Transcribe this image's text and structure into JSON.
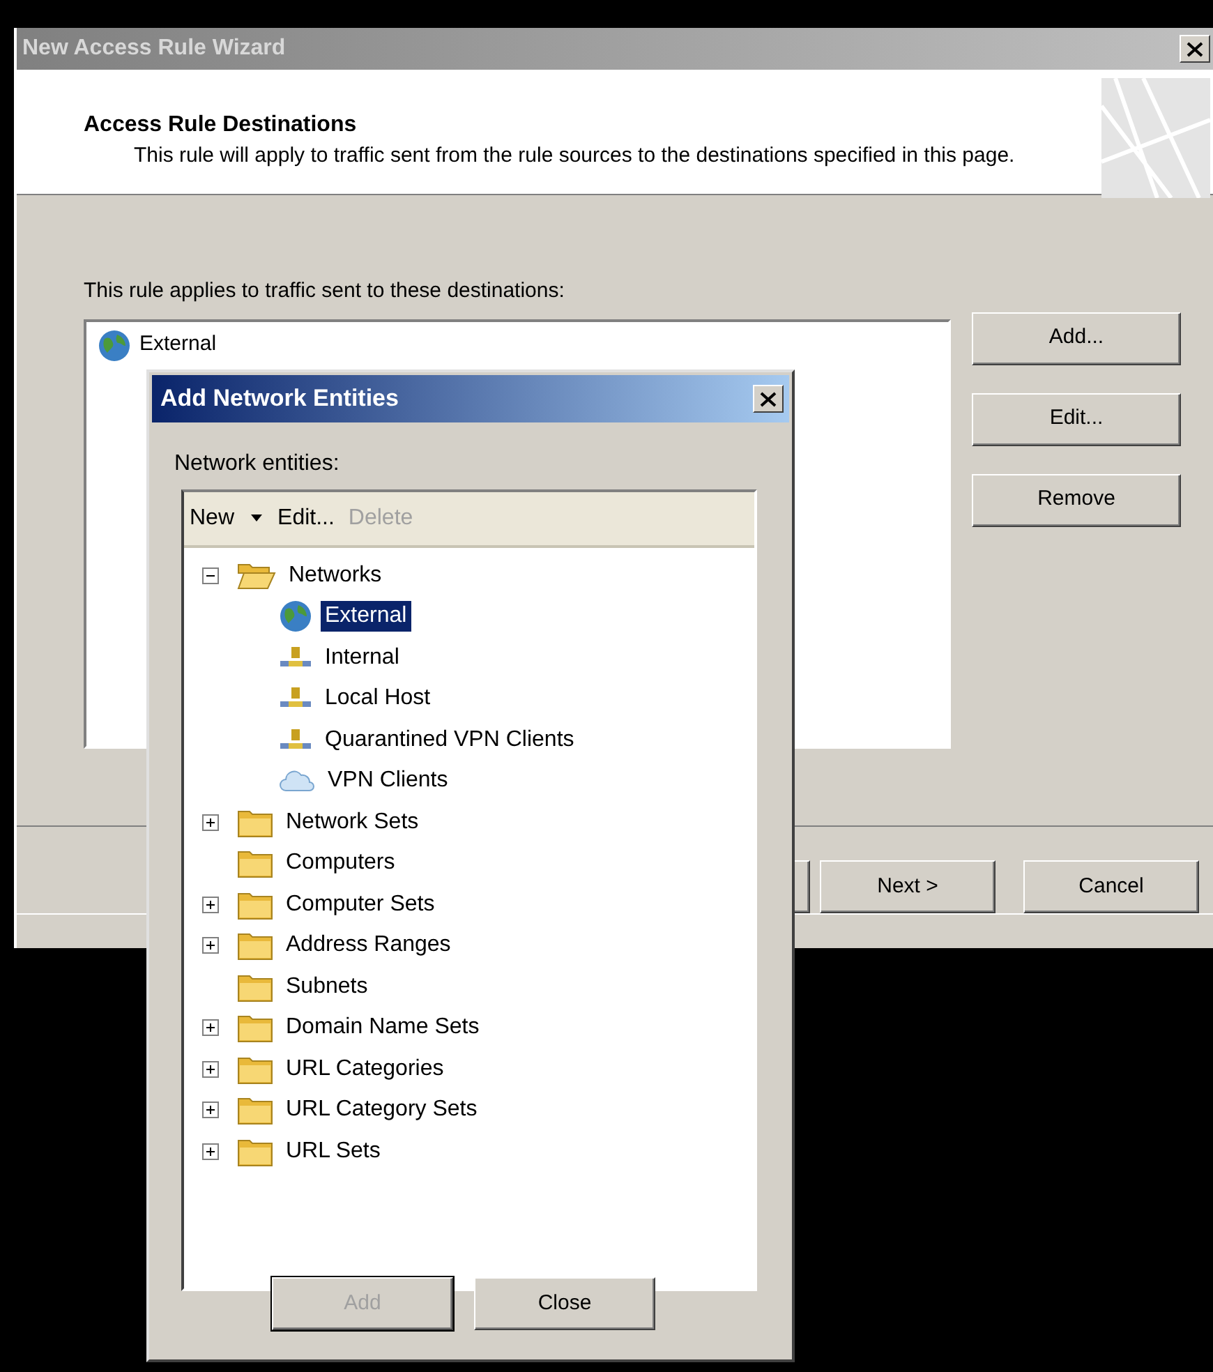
{
  "wizard": {
    "title": "New Access Rule Wizard",
    "header": {
      "heading": "Access Rule Destinations",
      "description": "This rule will apply to traffic sent from the rule sources to the destinations specified in this page."
    },
    "label": "This rule applies to traffic sent to these destinations:",
    "destinations": [
      {
        "label": "External",
        "kind": "globe"
      }
    ],
    "side_buttons": [
      {
        "label": "Add..."
      },
      {
        "label": "Edit..."
      },
      {
        "label": "Remove"
      }
    ],
    "footer_buttons": [
      {
        "label": "Next >"
      },
      {
        "label": "Cancel"
      }
    ]
  },
  "dialog": {
    "title": "Add Network Entities",
    "label": "Network entities:",
    "toolbar": [
      {
        "label": "New",
        "kind": "dropdown",
        "disabled": false
      },
      {
        "label": "Edit...",
        "kind": "button",
        "disabled": false
      },
      {
        "label": "Delete",
        "kind": "button",
        "disabled": true
      }
    ],
    "tree": [
      {
        "label": "Networks",
        "kind": "open-folder",
        "expanded": true,
        "selected": false,
        "children": [
          {
            "label": "External",
            "kind": "globe",
            "selected": true
          },
          {
            "label": "Internal",
            "kind": "network",
            "selected": false
          },
          {
            "label": "Local Host",
            "kind": "network",
            "selected": false
          },
          {
            "label": "Quarantined VPN Clients",
            "kind": "network",
            "selected": false
          },
          {
            "label": "VPN Clients",
            "kind": "cloud",
            "selected": false
          }
        ]
      },
      {
        "label": "Network Sets",
        "kind": "folder",
        "expanded": false,
        "selected": false
      },
      {
        "label": "Computers",
        "kind": "folder",
        "selected": false
      },
      {
        "label": "Computer Sets",
        "kind": "folder",
        "expanded": false,
        "selected": false
      },
      {
        "label": "Address Ranges",
        "kind": "folder",
        "expanded": false,
        "selected": false
      },
      {
        "label": "Subnets",
        "kind": "folder",
        "selected": false
      },
      {
        "label": "Domain Name Sets",
        "kind": "folder",
        "expanded": false,
        "selected": false
      },
      {
        "label": "URL Categories",
        "kind": "folder",
        "expanded": false,
        "selected": false
      },
      {
        "label": "URL Category Sets",
        "kind": "folder",
        "expanded": false,
        "selected": false
      },
      {
        "label": "URL Sets",
        "kind": "folder",
        "expanded": false,
        "selected": false
      }
    ],
    "buttons": [
      {
        "label": "Add",
        "disabled": true
      },
      {
        "label": "Close",
        "disabled": false
      }
    ]
  }
}
